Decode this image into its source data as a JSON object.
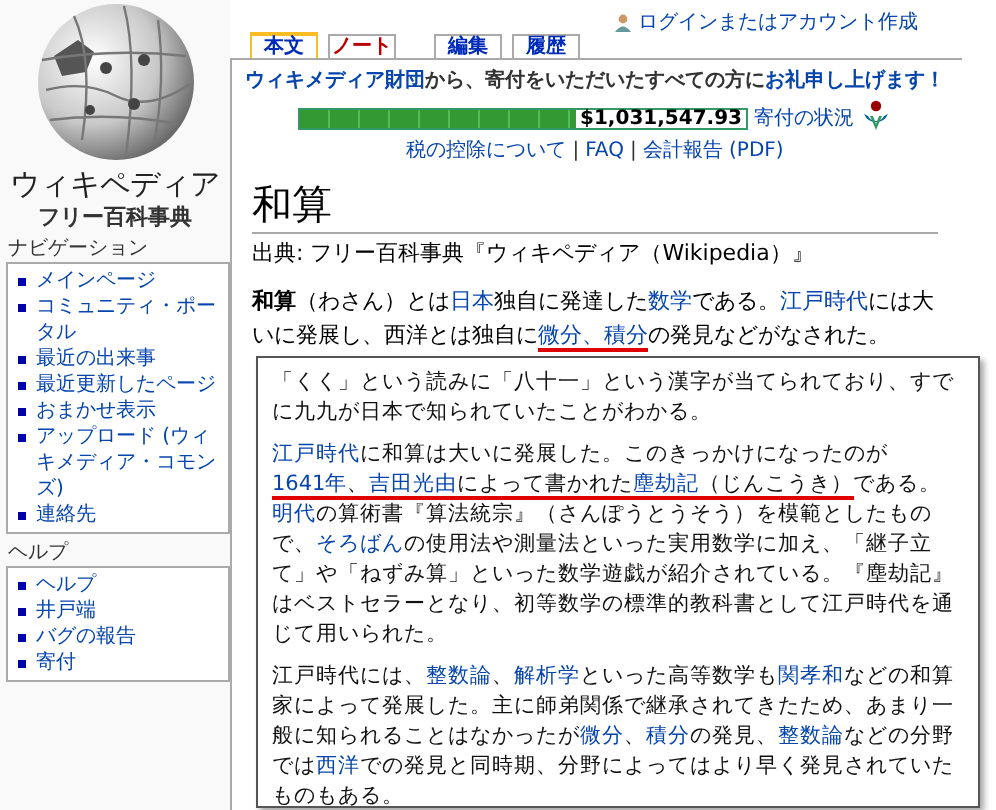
{
  "header": {
    "login": "ログインまたはアカウント作成"
  },
  "tabs": [
    {
      "label": "本文",
      "selected": true,
      "exists": true
    },
    {
      "label": "ノート",
      "selected": false,
      "exists": false
    },
    {
      "label": "編集",
      "selected": false,
      "exists": true
    },
    {
      "label": "履歴",
      "selected": false,
      "exists": true
    }
  ],
  "sidebar": {
    "logo_title": "ウィキペディア",
    "logo_subtitle": "フリー百科事典",
    "sections": [
      {
        "heading": "ナビゲーション",
        "items": [
          "メインページ",
          "コミュニティ・ポータル",
          "最近の出来事",
          "最近更新したページ",
          "おまかせ表示",
          "アップロード (ウィキメディア・コモンズ)",
          "連絡先"
        ]
      },
      {
        "heading": "ヘルプ",
        "items": [
          "ヘルプ",
          "井戸端",
          "バグの報告",
          "寄付"
        ]
      }
    ]
  },
  "banner": {
    "message": [
      {
        "kind": "link",
        "text": "ウィキメディア財団"
      },
      {
        "kind": "text",
        "text": "から、寄付をいただいたすべての方に"
      },
      {
        "kind": "link",
        "text": "お礼申し上げます！"
      }
    ],
    "progress": {
      "level": 0.67,
      "amount": "$1,031,547.93"
    },
    "status_link": "寄付の状況",
    "footer": [
      {
        "kind": "link",
        "text": "税の控除について"
      },
      {
        "kind": "sep",
        "text": "|"
      },
      {
        "kind": "link",
        "text": "FAQ"
      },
      {
        "kind": "sep",
        "text": "|"
      },
      {
        "kind": "link",
        "text": "会計報告 (PDF)"
      }
    ]
  },
  "article": {
    "title": "和算",
    "source": "出典: フリー百科事典『ウィキペディア（Wikipedia）』",
    "intro": [
      {
        "kind": "bold",
        "text": "和算",
        "underlined": false
      },
      {
        "kind": "text",
        "text": "（わさん）とは",
        "underlined": false
      },
      {
        "kind": "link",
        "text": "日本",
        "underlined": false
      },
      {
        "kind": "text",
        "text": "独自に発達した",
        "underlined": false
      },
      {
        "kind": "link",
        "text": "数学",
        "underlined": false
      },
      {
        "kind": "text",
        "text": "である。",
        "underlined": false
      },
      {
        "kind": "link",
        "text": "江戸時代",
        "underlined": false
      },
      {
        "kind": "text",
        "text": "には大いに発展し、西洋とは独自に",
        "underlined": false
      },
      {
        "kind": "link",
        "text": "微分、積分",
        "underlined": true
      },
      {
        "kind": "text",
        "text": "の発見などがなされた。",
        "underlined": false
      }
    ]
  },
  "excerpt": {
    "paragraphs": [
      [
        {
          "kind": "text",
          "text": "「くく」という読みに「八十一」という漢字が当てられており、すでに九九が日本で知られていたことがわかる。",
          "underlined": false
        }
      ],
      [
        {
          "kind": "link",
          "text": "江戸時代",
          "underlined": false
        },
        {
          "kind": "text",
          "text": "に和算は大いに発展した。このきっかけになったのが",
          "underlined": false
        },
        {
          "kind": "link",
          "text": "1641年",
          "underlined": true
        },
        {
          "kind": "text",
          "text": "、",
          "underlined": true
        },
        {
          "kind": "link",
          "text": "吉田光由",
          "underlined": true
        },
        {
          "kind": "text",
          "text": "によって書かれた",
          "underlined": true
        },
        {
          "kind": "link",
          "text": "塵劫記",
          "underlined": true
        },
        {
          "kind": "text",
          "text": "（じんこうき）",
          "underlined": true
        },
        {
          "kind": "text",
          "text": "である。",
          "underlined": false
        },
        {
          "kind": "link",
          "text": "明代",
          "underlined": false
        },
        {
          "kind": "text",
          "text": "の算術書『算法統宗』（さんぽうとうそう）を模範としたもので、",
          "underlined": false
        },
        {
          "kind": "link",
          "text": "そろばん",
          "underlined": false
        },
        {
          "kind": "text",
          "text": "の使用法や測量法といった実用数学に加え、「継子立て」や「ねずみ算」といった数学遊戯が紹介されている。『塵劫記』はベストセラーとなり、初等数学の標準的教科書として江戸時代を通じて用いられた。",
          "underlined": false
        }
      ],
      [
        {
          "kind": "text",
          "text": "江戸時代には、",
          "underlined": false
        },
        {
          "kind": "link",
          "text": "整数論",
          "underlined": false
        },
        {
          "kind": "text",
          "text": "、",
          "underlined": false
        },
        {
          "kind": "link",
          "text": "解析学",
          "underlined": false
        },
        {
          "kind": "text",
          "text": "といった高等数学も",
          "underlined": false
        },
        {
          "kind": "link",
          "text": "関孝和",
          "underlined": false
        },
        {
          "kind": "text",
          "text": "などの和算家によって発展した。主に師弟関係で継承されてきたため、あまり一般に知られることはなかったが",
          "underlined": false
        },
        {
          "kind": "link",
          "text": "微分",
          "underlined": false
        },
        {
          "kind": "text",
          "text": "、",
          "underlined": false
        },
        {
          "kind": "link",
          "text": "積分",
          "underlined": false
        },
        {
          "kind": "text",
          "text": "の発見、",
          "underlined": false
        },
        {
          "kind": "link",
          "text": "整数論",
          "underlined": false
        },
        {
          "kind": "text",
          "text": "などの分野では",
          "underlined": false
        },
        {
          "kind": "link",
          "text": "西洋",
          "underlined": false
        },
        {
          "kind": "text",
          "text": "での発見と同時期、分野によってはより早く発見されていたものもある。",
          "underlined": false
        }
      ]
    ]
  }
}
